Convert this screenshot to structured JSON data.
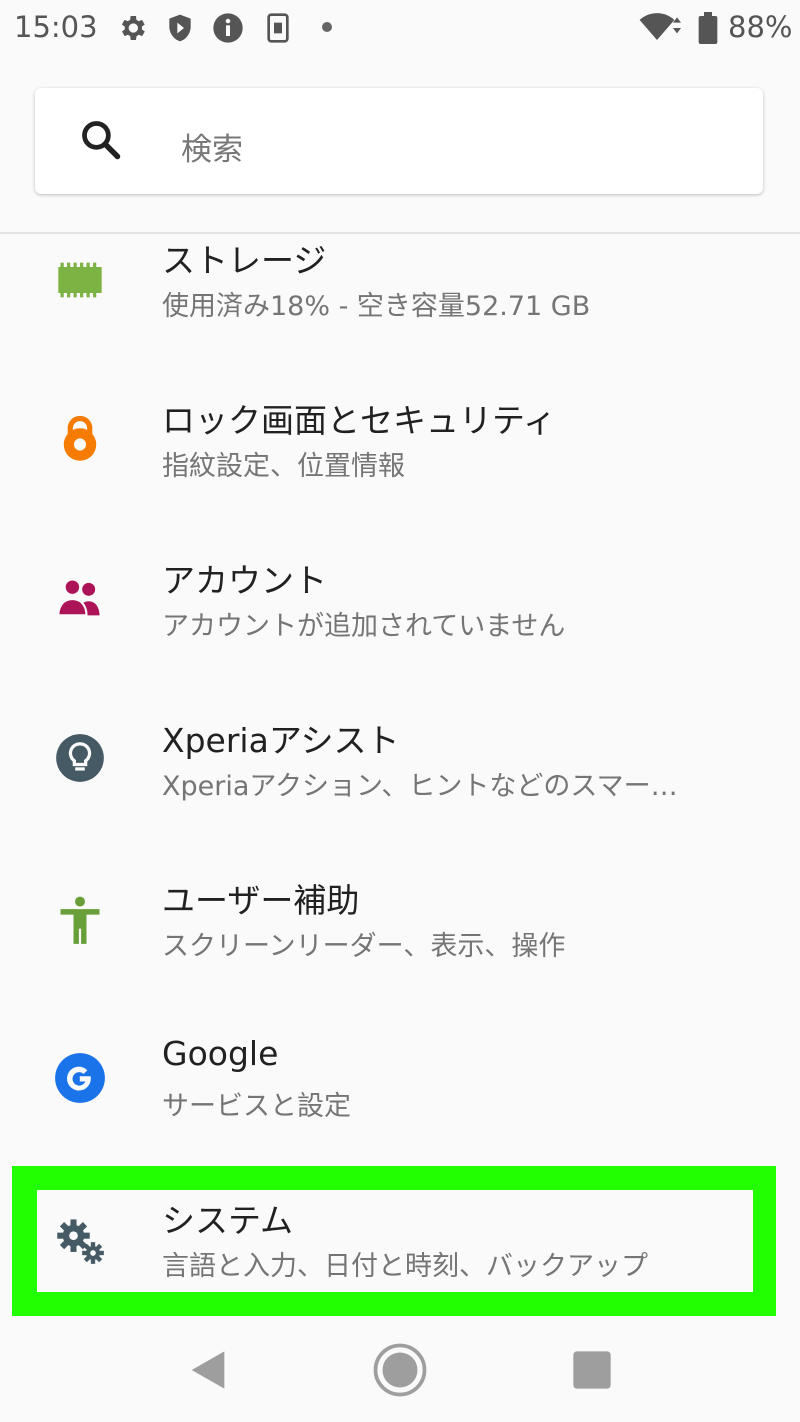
{
  "status_bar": {
    "time": "15:03",
    "battery": "88%",
    "icons": [
      "gear-icon",
      "shield-icon",
      "info-icon",
      "sim-icon",
      "dot-icon",
      "wifi-icon",
      "battery-icon"
    ]
  },
  "search": {
    "placeholder": "検索"
  },
  "settings": [
    {
      "title": "ストレージ",
      "subtitle": "使用済み18% - 空き容量52.71 GB",
      "icon": "storage-icon",
      "color": "#7cb342"
    },
    {
      "title": "ロック画面とセキュリティ",
      "subtitle": "指紋設定、位置情報",
      "icon": "lock-icon",
      "color": "#f57c00"
    },
    {
      "title": "アカウント",
      "subtitle": "アカウントが追加されていません",
      "icon": "accounts-icon",
      "color": "#ad1457"
    },
    {
      "title": "Xperiaアシスト",
      "subtitle": "Xperiaアクション、ヒントなどのスマー…",
      "icon": "lightbulb-icon",
      "color": "#455a64"
    },
    {
      "title": "ユーザー補助",
      "subtitle": "スクリーンリーダー、表示、操作",
      "icon": "accessibility-icon",
      "color": "#689f38"
    },
    {
      "title": "Google",
      "subtitle": "サービスと設定",
      "icon": "google-icon",
      "color": "#1a73e8"
    },
    {
      "title": "システム",
      "subtitle": "言語と入力、日付と時刻、バックアップ",
      "icon": "gears-icon",
      "color": "#455a64"
    }
  ],
  "highlight_color": "#22ff00",
  "nav": {
    "icons": [
      "back-icon",
      "home-icon",
      "recents-icon"
    ]
  }
}
